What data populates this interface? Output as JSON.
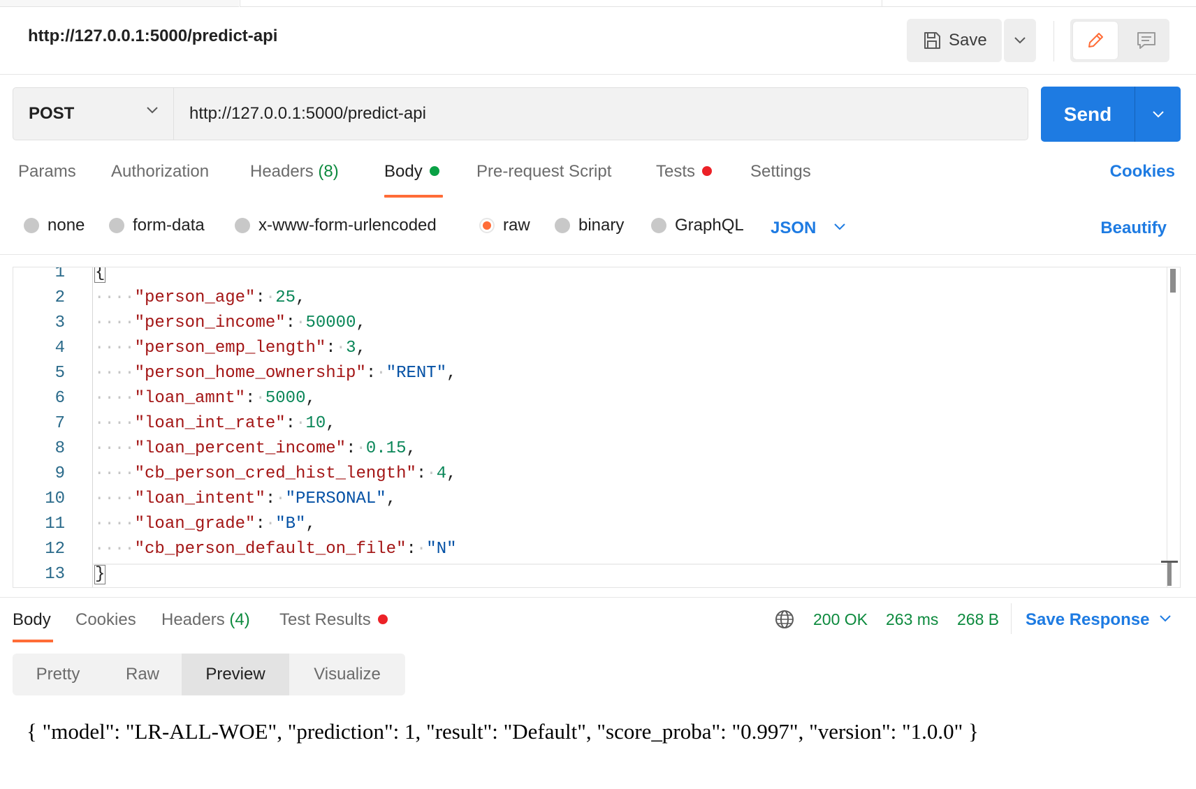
{
  "request": {
    "title": "http://127.0.0.1:5000/predict-api",
    "save_label": "Save",
    "method": "POST",
    "url": "http://127.0.0.1:5000/predict-api",
    "send_label": "Send"
  },
  "request_tabs": {
    "params": "Params",
    "authorization": "Authorization",
    "headers": "Headers",
    "headers_count": "(8)",
    "body": "Body",
    "pre_request": "Pre-request Script",
    "tests": "Tests",
    "settings": "Settings",
    "cookies": "Cookies"
  },
  "body_types": {
    "none": "none",
    "form_data": "form-data",
    "urlencoded": "x-www-form-urlencoded",
    "raw": "raw",
    "binary": "binary",
    "graphql": "GraphQL",
    "language": "JSON",
    "beautify": "Beautify"
  },
  "editor": {
    "lines": [
      {
        "n": "1",
        "open": "{"
      },
      {
        "n": "2",
        "key": "\"person_age\"",
        "value": "25",
        "type": "num",
        "comma": ","
      },
      {
        "n": "3",
        "key": "\"person_income\"",
        "value": "50000",
        "type": "num",
        "comma": ","
      },
      {
        "n": "4",
        "key": "\"person_emp_length\"",
        "value": "3",
        "type": "num",
        "comma": ","
      },
      {
        "n": "5",
        "key": "\"person_home_ownership\"",
        "value": "\"RENT\"",
        "type": "str",
        "comma": ","
      },
      {
        "n": "6",
        "key": "\"loan_amnt\"",
        "value": "5000",
        "type": "num",
        "comma": ","
      },
      {
        "n": "7",
        "key": "\"loan_int_rate\"",
        "value": "10",
        "type": "num",
        "comma": ","
      },
      {
        "n": "8",
        "key": "\"loan_percent_income\"",
        "value": "0.15",
        "type": "num",
        "comma": ","
      },
      {
        "n": "9",
        "key": "\"cb_person_cred_hist_length\"",
        "value": "4",
        "type": "num",
        "comma": ","
      },
      {
        "n": "10",
        "key": "\"loan_intent\"",
        "value": "\"PERSONAL\"",
        "type": "str",
        "comma": ","
      },
      {
        "n": "11",
        "key": "\"loan_grade\"",
        "value": "\"B\"",
        "type": "str",
        "comma": ","
      },
      {
        "n": "12",
        "key": "\"cb_person_default_on_file\"",
        "value": "\"N\"",
        "type": "str",
        "comma": ""
      },
      {
        "n": "13",
        "close": "}"
      }
    ]
  },
  "response_tabs": {
    "body": "Body",
    "cookies": "Cookies",
    "headers": "Headers",
    "headers_count": "(4)",
    "test_results": "Test Results"
  },
  "response_status": {
    "status": "200 OK",
    "time": "263 ms",
    "size": "268 B",
    "save_response": "Save Response"
  },
  "view_modes": {
    "pretty": "Pretty",
    "raw": "Raw",
    "preview": "Preview",
    "visualize": "Visualize"
  },
  "response_preview": "{ \"model\": \"LR-ALL-WOE\", \"prediction\": 1, \"result\": \"Default\", \"score_proba\": \"0.997\", \"version\": \"1.0.0\" }",
  "colors": {
    "accent": "#ff6c37",
    "primary": "#1e7be2",
    "success": "#0d8a3e",
    "error": "#ec2127"
  }
}
